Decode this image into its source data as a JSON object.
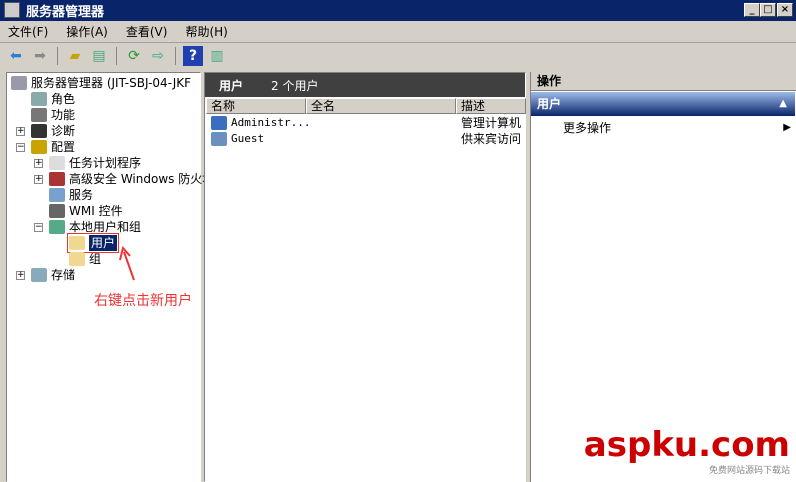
{
  "window": {
    "title": "服务器管理器",
    "controls": [
      "_",
      "□",
      "×"
    ]
  },
  "menu": [
    "文件(F)",
    "操作(A)",
    "查看(V)",
    "帮助(H)"
  ],
  "toolbar": [
    "back",
    "forward",
    "up",
    "show-hide-tree",
    "refresh",
    "export",
    "help",
    "show-hide-action"
  ],
  "tree": {
    "root": "服务器管理器 (JIT-SBJ-04-JKF",
    "items": [
      {
        "label": "角色",
        "level": 1,
        "expander": "",
        "icon": "roles-icon",
        "color": "#8aa"
      },
      {
        "label": "功能",
        "level": 1,
        "expander": "",
        "icon": "features-icon",
        "color": "#777"
      },
      {
        "label": "诊断",
        "level": 1,
        "expander": "+",
        "icon": "diagnostics-icon",
        "color": "#333"
      },
      {
        "label": "配置",
        "level": 1,
        "expander": "−",
        "icon": "configuration-icon",
        "color": "#c9a400"
      },
      {
        "label": "任务计划程序",
        "level": 2,
        "expander": "+",
        "icon": "clock-icon",
        "color": "#ddd"
      },
      {
        "label": "高级安全 Windows 防火墙",
        "level": 2,
        "expander": "+",
        "icon": "firewall-icon",
        "color": "#a33"
      },
      {
        "label": "服务",
        "level": 2,
        "expander": "",
        "icon": "gear-icon",
        "color": "#7aa0cc"
      },
      {
        "label": "WMI 控件",
        "level": 2,
        "expander": "",
        "icon": "wmi-icon",
        "color": "#666"
      },
      {
        "label": "本地用户和组",
        "level": 2,
        "expander": "−",
        "icon": "users-group-icon",
        "color": "#5a8"
      },
      {
        "label": "用户",
        "level": 3,
        "expander": "",
        "icon": "folder-icon",
        "color": "#f0d890",
        "selected": true
      },
      {
        "label": "组",
        "level": 3,
        "expander": "",
        "icon": "folder-icon",
        "color": "#f0d890"
      },
      {
        "label": "存储",
        "level": 1,
        "expander": "+",
        "icon": "storage-icon",
        "color": "#8ab"
      }
    ]
  },
  "annotation": "右键点击新用户",
  "middle": {
    "title": "用户",
    "count": "2 个用户",
    "columns": [
      "名称",
      "全名",
      "描述"
    ],
    "rows": [
      {
        "name": "Administr...",
        "fullname": "",
        "desc": "管理计算机"
      },
      {
        "name": "Guest",
        "fullname": "",
        "desc": "供来宾访问"
      }
    ]
  },
  "actions": {
    "title": "操作",
    "section": "用户",
    "items": [
      "更多操作"
    ]
  },
  "watermark": {
    "brand": "aspku.com",
    "sub": "免费网站源码下载站"
  }
}
